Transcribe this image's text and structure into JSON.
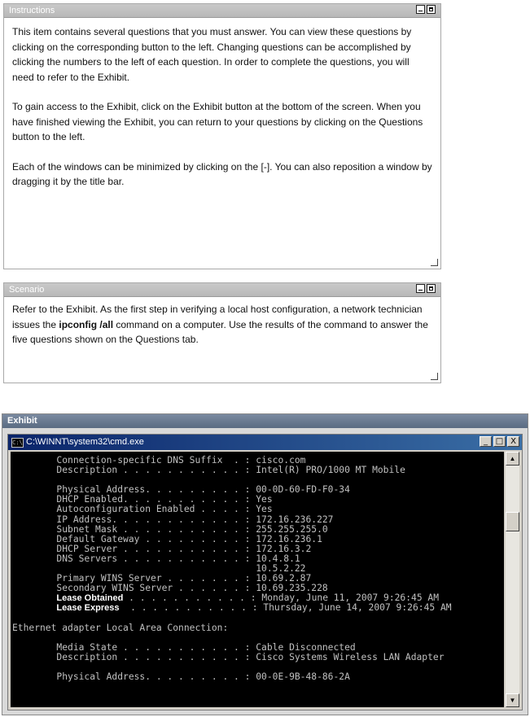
{
  "instructions": {
    "title": "Instructions",
    "paragraphs": [
      "This item contains several questions that you must answer. You can view these questions by clicking on the corresponding button to the left. Changing questions can be accomplished by clicking the numbers to the left of each question. In order to complete the questions, you will need to refer to the Exhibit.",
      "To gain access to the Exhibit, click on the Exhibit button at the bottom of the screen. When you have finished viewing the Exhibit, you can return to your questions by clicking on the Questions button to the left.",
      "Each of the windows can be minimized by clicking on the [-]. You can also reposition a window by dragging it by the title bar."
    ]
  },
  "scenario": {
    "title": "Scenario",
    "text_before": "Refer to the Exhibit. As the first step in verifying a local host configuration, a network technician issues the ",
    "command": "ipconfig /all",
    "text_after": " command on a computer.  Use the results of the command to answer the five questions shown on the Questions tab."
  },
  "exhibit": {
    "title": "Exhibit",
    "window_title": "C:\\WINNT\\system32\\cmd.exe",
    "window_buttons": [
      "_",
      "□",
      "X"
    ],
    "lines": [
      {
        "text": "        Connection-specific DNS Suffix  . : cisco.com"
      },
      {
        "text": "        Description . . . . . . . . . . . : Intel(R) PRO/1000 MT Mobile"
      },
      {
        "text": ""
      },
      {
        "text": "        Physical Address. . . . . . . . . : 00-0D-60-FD-F0-34"
      },
      {
        "text": "        DHCP Enabled. . . . . . . . . . . : Yes"
      },
      {
        "text": "        Autoconfiguration Enabled . . . . : Yes"
      },
      {
        "text": "        IP Address. . . . . . . . . . . . : 172.16.236.227"
      },
      {
        "text": "        Subnet Mask . . . . . . . . . . . : 255.255.255.0"
      },
      {
        "text": "        Default Gateway . . . . . . . . . : 172.16.236.1"
      },
      {
        "text": "        DHCP Server . . . . . . . . . . . : 172.16.3.2"
      },
      {
        "text": "        DNS Servers . . . . . . . . . . . : 10.4.8.1"
      },
      {
        "text": "                                            10.5.2.22"
      },
      {
        "text": "        Primary WINS Server . . . . . . . : 10.69.2.87"
      },
      {
        "text": "        Secondary WINS Server . . . . . . : 10.69.235.228"
      },
      {
        "label": "Lease Obtained",
        "dots": " . . . . . . . . . . . : ",
        "value": "Monday, June 11, 2007 9:26:45 AM"
      },
      {
        "label": "Lease Express",
        "dots": "  . . . . . . . . . . . : ",
        "value": "Thursday, June 14, 2007 9:26:45 AM"
      },
      {
        "text": ""
      },
      {
        "text": "Ethernet adapter Local Area Connection:"
      },
      {
        "text": ""
      },
      {
        "text": "        Media State . . . . . . . . . . . : Cable Disconnected"
      },
      {
        "text": "        Description . . . . . . . . . . . : Cisco Systems Wireless LAN Adapter"
      },
      {
        "text": ""
      },
      {
        "text": "        Physical Address. . . . . . . . . : 00-0E-9B-48-86-2A"
      }
    ]
  }
}
